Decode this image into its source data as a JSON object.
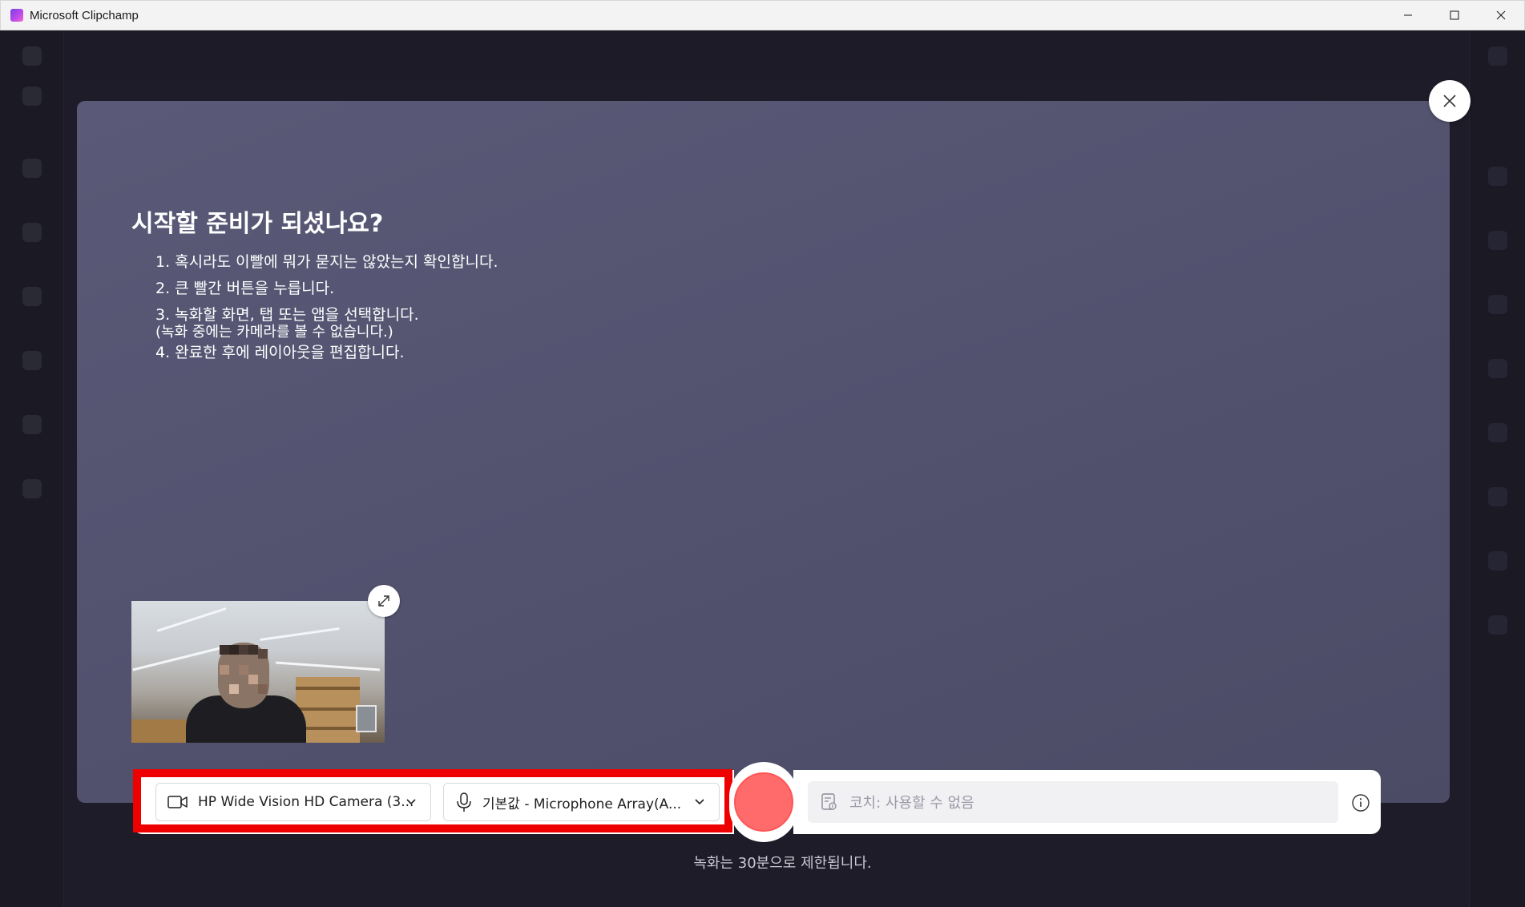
{
  "window": {
    "title": "Microsoft Clipchamp",
    "minimize_glyph": "—",
    "maximize_glyph": "☐",
    "close_glyph": "✕"
  },
  "recorder": {
    "heading": "시작할 준비가 되셨나요?",
    "steps": [
      "1. 혹시라도 이빨에 뭐가 묻지는 않았는지 확인합니다.",
      "2. 큰 빨간 버튼을 누릅니다.",
      "3. 녹화할 화면, 탭 또는 앱을 선택합니다.",
      "(녹화 중에는 카메라를 볼 수 없습니다.)",
      "4. 완료한 후에 레이아웃을 편집합니다."
    ],
    "camera_select": {
      "value": "HP Wide Vision HD Camera (3...",
      "icon": "camera-icon"
    },
    "microphone_select": {
      "value": "기본값 - Microphone Array(A...",
      "icon": "microphone-icon"
    },
    "coach": {
      "value": "코치: 사용할 수 없음",
      "icon": "coach-icon"
    },
    "limit_text": "녹화는 30분으로 제한됩니다.",
    "record_color": "#ff6b6b",
    "highlight_color": "#ee0000"
  }
}
